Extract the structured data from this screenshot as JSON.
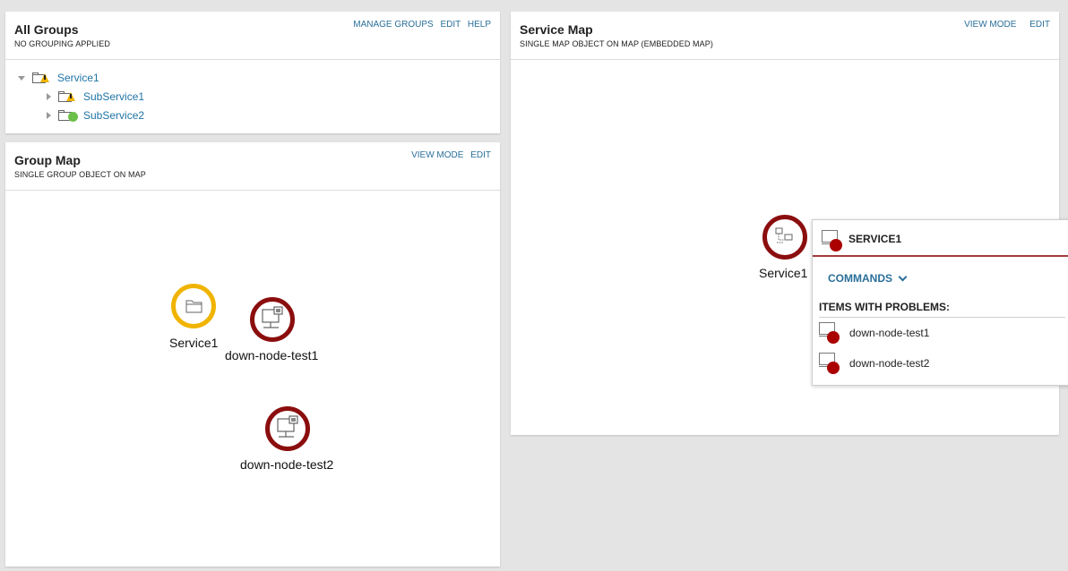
{
  "all_groups": {
    "title": "All Groups",
    "subtitle": "NO GROUPING APPLIED",
    "links": [
      "MANAGE GROUPS",
      "EDIT",
      "HELP"
    ],
    "tree": [
      {
        "label": "Service1",
        "status": "warning",
        "expanded": true,
        "level": 0
      },
      {
        "label": "SubService1",
        "status": "warning",
        "expanded": false,
        "level": 1
      },
      {
        "label": "SubService2",
        "status": "up",
        "expanded": false,
        "level": 1
      }
    ]
  },
  "group_map": {
    "title": "Group Map",
    "subtitle": "SINGLE GROUP OBJECT ON MAP",
    "links": [
      "VIEW MODE",
      "EDIT"
    ],
    "nodes": [
      {
        "label": "Service1",
        "status": "warning",
        "icon": "folder-icon"
      },
      {
        "label": "down-node-test1",
        "status": "down",
        "icon": "computer-node-icon"
      },
      {
        "label": "down-node-test2",
        "status": "down",
        "icon": "computer-node-icon"
      }
    ]
  },
  "service_map": {
    "title": "Service Map",
    "subtitle": "SINGLE MAP OBJECT ON MAP (EMBEDDED MAP)",
    "links": [
      "VIEW MODE",
      "EDIT"
    ],
    "nodes": [
      {
        "label": "Service1",
        "status": "down",
        "icon": "network-map-icon"
      }
    ]
  },
  "popup": {
    "title": "SERVICE1",
    "commands_label": "COMMANDS",
    "problems_header": "ITEMS WITH PROBLEMS:",
    "problems": [
      "down-node-test1",
      "down-node-test2"
    ]
  },
  "colors": {
    "link": "#2a6f9a",
    "tree_link": "#1f74a6",
    "warning": "#f0b400",
    "down": "#8b0e0e",
    "up": "#6cbf4a"
  }
}
